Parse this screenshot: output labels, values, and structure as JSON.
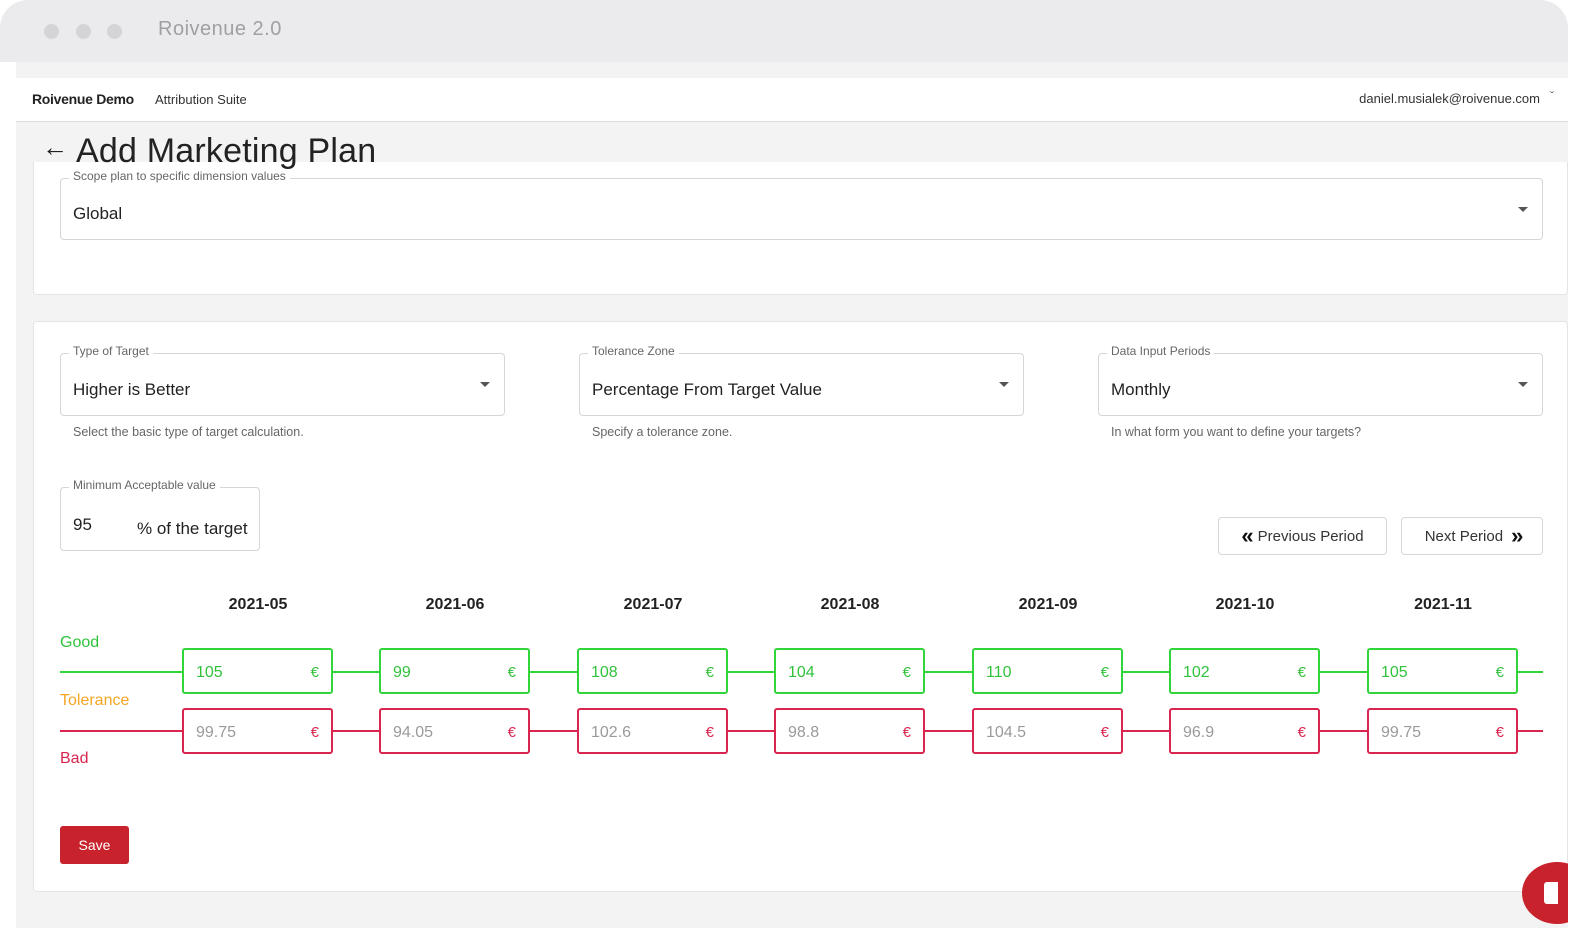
{
  "window": {
    "title": "Roivenue 2.0"
  },
  "topnav": {
    "brand": "Roivenue Demo",
    "suite": "Attribution Suite",
    "user_email": "daniel.musialek@roivenue.com",
    "user_caret": "ˇ"
  },
  "page": {
    "back_icon": "←",
    "title": "Add Marketing Plan"
  },
  "scope": {
    "label": "Scope plan to specific dimension values",
    "value": "Global"
  },
  "type_of_target": {
    "label": "Type of Target",
    "value": "Higher is Better",
    "helper": "Select the basic type of target calculation."
  },
  "tolerance_zone": {
    "label": "Tolerance Zone",
    "value": "Percentage From Target Value",
    "helper": "Specify a tolerance zone."
  },
  "data_input_periods": {
    "label": "Data Input Periods",
    "value": "Monthly",
    "helper": "In what form you want to define your targets?"
  },
  "minimum_acceptable": {
    "label": "Minimum Acceptable value",
    "value": "95",
    "suffix": "% of the target"
  },
  "navigation": {
    "previous_label": "Previous Period",
    "next_label": "Next Period",
    "previous_icon": "«",
    "next_icon": "»"
  },
  "legend": {
    "good": "Good",
    "tolerance": "Tolerance",
    "bad": "Bad"
  },
  "currency": "€",
  "periods": [
    {
      "month": "2021-05",
      "good": "105",
      "bad": "99.75"
    },
    {
      "month": "2021-06",
      "good": "99",
      "bad": "94.05"
    },
    {
      "month": "2021-07",
      "good": "108",
      "bad": "102.6"
    },
    {
      "month": "2021-08",
      "good": "104",
      "bad": "98.8"
    },
    {
      "month": "2021-09",
      "good": "110",
      "bad": "104.5"
    },
    {
      "month": "2021-10",
      "good": "102",
      "bad": "96.9"
    },
    {
      "month": "2021-11",
      "good": "105",
      "bad": "99.75"
    }
  ],
  "colors": {
    "good": "#31d43b",
    "tolerance": "#f5a623",
    "bad": "#d9254f",
    "save": "#c8232c"
  },
  "save_label": "Save"
}
